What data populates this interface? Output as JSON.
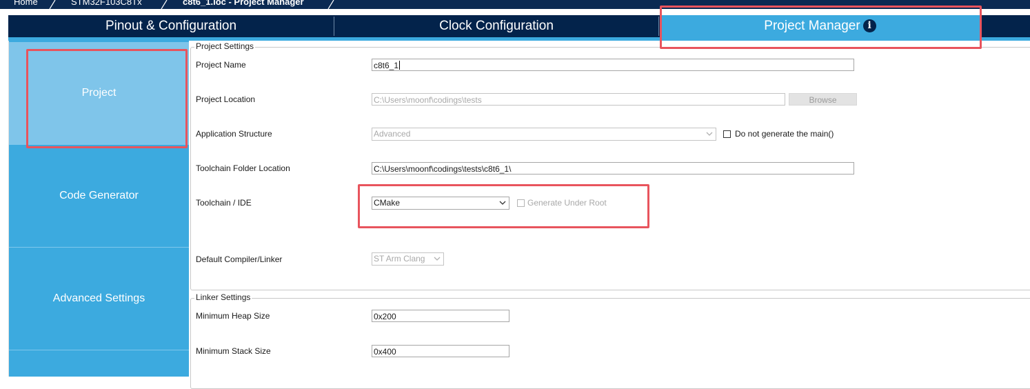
{
  "breadcrumb": {
    "home": "Home",
    "mcu": "STM32F103C8Tx",
    "file": "c8t6_1.ioc - Project Manager"
  },
  "tabs": {
    "pinout": "Pinout & Configuration",
    "clock": "Clock Configuration",
    "project_manager": "Project Manager",
    "info_glyph": "i"
  },
  "sidebar": {
    "items": [
      {
        "label": "Project"
      },
      {
        "label": "Code Generator"
      },
      {
        "label": "Advanced Settings"
      }
    ]
  },
  "project_settings": {
    "title": "Project Settings",
    "project_name": {
      "label": "Project Name",
      "value": "c8t6_1"
    },
    "project_location": {
      "label": "Project Location",
      "value": "C:\\Users\\moonf\\codings\\tests",
      "browse": "Browse"
    },
    "application_structure": {
      "label": "Application Structure",
      "value": "Advanced",
      "checkbox_label": "Do not generate the main()"
    },
    "toolchain_folder": {
      "label": "Toolchain Folder Location",
      "value": "C:\\Users\\moonf\\codings\\tests\\c8t6_1\\"
    },
    "toolchain_ide": {
      "label": "Toolchain / IDE",
      "value": "CMake",
      "checkbox_label": "Generate Under Root"
    },
    "compiler": {
      "label": "Default Compiler/Linker",
      "value": "ST Arm Clang"
    }
  },
  "linker_settings": {
    "title": "Linker Settings",
    "heap": {
      "label": "Minimum Heap Size",
      "value": "0x200"
    },
    "stack": {
      "label": "Minimum Stack Size",
      "value": "0x400"
    }
  },
  "colors": {
    "nav_dark": "#03234b",
    "accent": "#3caadf",
    "highlight": "#e8545d"
  }
}
